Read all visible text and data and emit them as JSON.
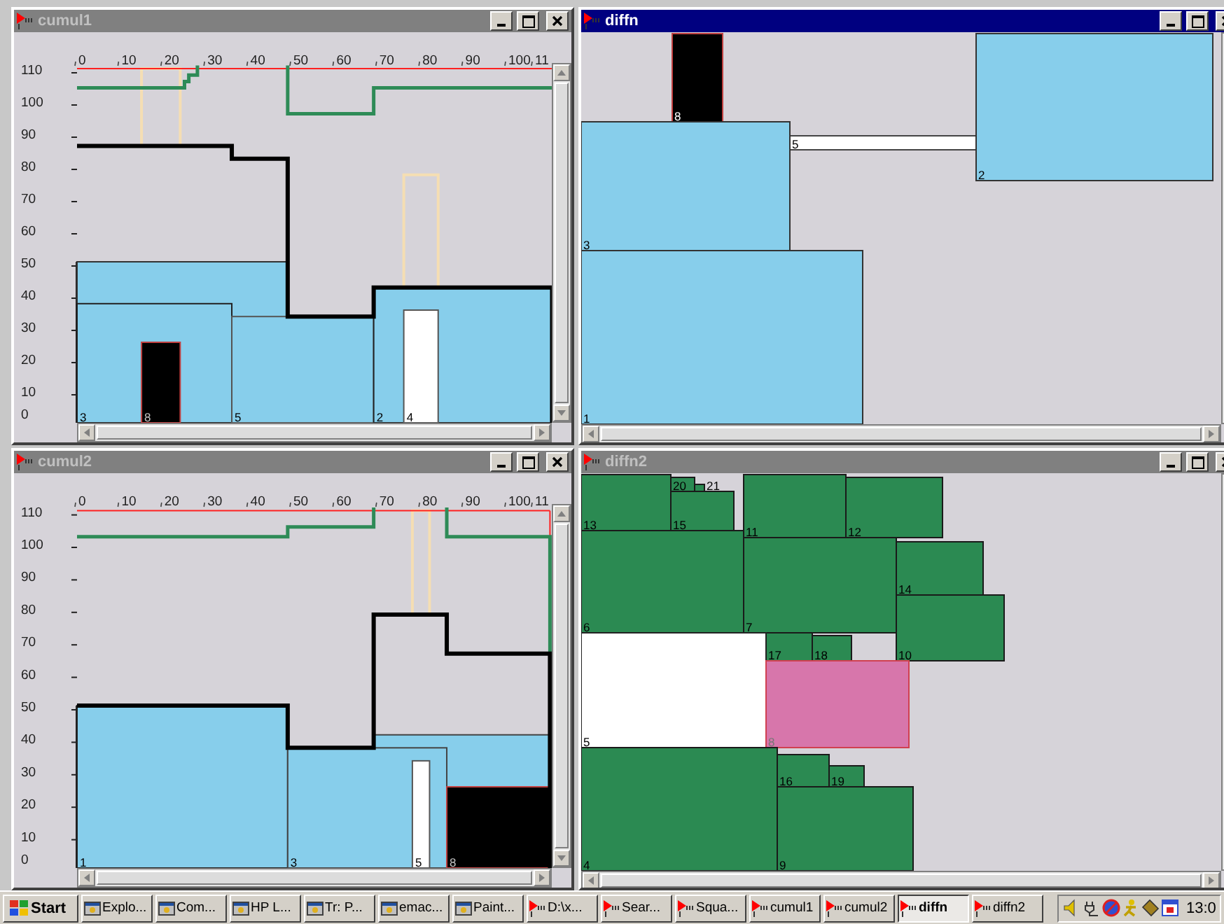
{
  "windows": [
    {
      "title": "cumul1",
      "active": false,
      "kind": "cumulative",
      "x_ticks": [
        "0",
        "10",
        "20",
        "30",
        "40",
        "50",
        "60",
        "70",
        "80",
        "90",
        "100",
        "11"
      ],
      "y_ticks": [
        "110",
        "100",
        "90",
        "80",
        "70",
        "60",
        "50",
        "40",
        "30",
        "20",
        "10",
        "0"
      ],
      "task_labels": [
        "3",
        "8",
        "5",
        "2",
        "4"
      ]
    },
    {
      "title": "diffn",
      "active": true,
      "kind": "placement",
      "box_labels": [
        "8",
        "5",
        "2",
        "3",
        "1"
      ]
    },
    {
      "title": "cumul2",
      "active": false,
      "kind": "cumulative",
      "x_ticks": [
        "0",
        "10",
        "20",
        "30",
        "40",
        "50",
        "60",
        "70",
        "80",
        "90",
        "100",
        "11"
      ],
      "y_ticks": [
        "110",
        "100",
        "90",
        "80",
        "70",
        "60",
        "50",
        "40",
        "30",
        "20",
        "10",
        "0"
      ],
      "task_labels": [
        "1",
        "3",
        "5",
        "8"
      ]
    },
    {
      "title": "diffn2",
      "active": false,
      "kind": "placement",
      "box_labels": [
        "20",
        "21",
        "13",
        "15",
        "11",
        "12",
        "14",
        "6",
        "7",
        "17",
        "18",
        "10",
        "5",
        "8",
        "16",
        "19",
        "4",
        "9"
      ]
    }
  ],
  "taskbar": {
    "start": "Start",
    "items": [
      {
        "label": "Explo...",
        "kind": "program",
        "selected": false
      },
      {
        "label": "Com...",
        "kind": "program",
        "selected": false
      },
      {
        "label": "HP L...",
        "kind": "program",
        "selected": false
      },
      {
        "label": "Tr: P...",
        "kind": "program",
        "selected": false
      },
      {
        "label": "emac...",
        "kind": "program",
        "selected": false
      },
      {
        "label": "Paint...",
        "kind": "program",
        "selected": false
      },
      {
        "label": "D:\\x...",
        "kind": "app",
        "selected": false
      },
      {
        "label": "Sear...",
        "kind": "app",
        "selected": false
      },
      {
        "label": "Squa...",
        "kind": "app",
        "selected": false
      },
      {
        "label": "cumul1",
        "kind": "app",
        "selected": false
      },
      {
        "label": "cumul2",
        "kind": "app",
        "selected": false
      },
      {
        "label": "diffn",
        "kind": "app",
        "selected": true
      },
      {
        "label": "diffn2",
        "kind": "app",
        "selected": false
      }
    ],
    "clock": "13:0"
  }
}
